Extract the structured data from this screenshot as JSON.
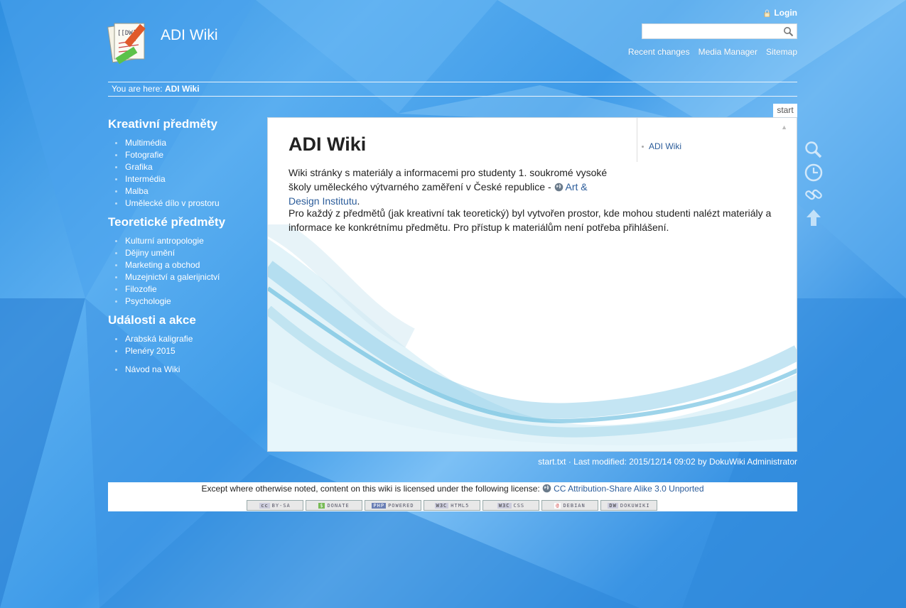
{
  "header": {
    "site_title": "ADI Wiki",
    "login_label": "Login",
    "search_placeholder": "",
    "nav": [
      "Recent changes",
      "Media Manager",
      "Sitemap"
    ]
  },
  "breadcrumb": {
    "prefix": "You are here:",
    "current": "ADI Wiki"
  },
  "sidebar": {
    "sections": [
      {
        "title": "Kreativní předměty",
        "items": [
          "Multimédia",
          "Fotografie",
          "Grafika",
          "Intermédia",
          "Malba",
          "Umělecké dílo v prostoru"
        ]
      },
      {
        "title": "Teoretické předměty",
        "items": [
          "Kulturní antropologie",
          "Dějiny umění",
          "Marketing a obchod",
          "Muzejnictví a galerijnictví",
          "Filozofie",
          "Psychologie"
        ]
      },
      {
        "title": "Události a akce",
        "items": [
          "Arabská kaligrafie",
          "Plenéry 2015"
        ]
      }
    ],
    "extra_item": "Návod na Wiki"
  },
  "page_tab": "start",
  "content": {
    "title": "ADI Wiki",
    "p1_text": "Wiki stránky s materiály a informacemi pro studenty 1. soukromé vysoké školy uměleckého výtvarného zaměření v České republice - ",
    "p1_link": "Art & Design Institutu",
    "p1_end": ".",
    "p2_text": "Pro každý z předmětů (jak kreativní tak teoretický) byl vytvořen prostor, kde mohou studenti nalézt materiály a informace ke konkrétnímu předmětu. Pro přístup k materiálům není potřeba přihlášení.",
    "toc_item": "ADI Wiki"
  },
  "page_tools": [
    "magnifier-icon",
    "clock-icon",
    "link-icon",
    "arrow-up-icon"
  ],
  "meta": "start.txt · Last modified: 2015/12/14 09:02 by DokuWiki Administrator",
  "footer": {
    "license_text": "Except where otherwise noted, content on this wiki is licensed under the following license: ",
    "license_link": "CC Attribution-Share Alike 3.0 Unported",
    "badges": [
      "BY-SA",
      "DONATE",
      "POWERED",
      "HTML5",
      "CSS",
      "DEBIAN",
      "DOKUWIKI"
    ],
    "badge_prefixes": [
      "cc",
      "$",
      "PHP",
      "W3C",
      "W3C",
      "@",
      "DW"
    ]
  },
  "colors": {
    "background": "#3d9ae8",
    "link": "#2b5c9a",
    "panel": "#ffffff"
  }
}
